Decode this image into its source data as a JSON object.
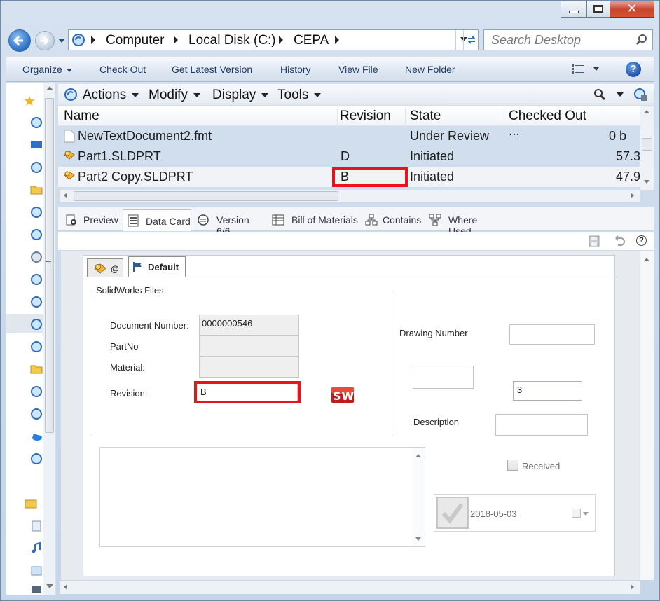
{
  "window": {
    "minimize_icon": "minimize-icon",
    "maximize_icon": "maximize-icon",
    "close_icon": "close-icon"
  },
  "address_bar": {
    "crumbs": [
      "Computer",
      "Local Disk (C:)",
      "CEPA"
    ],
    "search_placeholder": "Search Desktop"
  },
  "command_bar": {
    "items": [
      "Organize",
      "Check Out",
      "Get Latest Version",
      "History",
      "View File",
      "New Folder"
    ]
  },
  "pdm_menu": {
    "items": [
      "Actions",
      "Modify",
      "Display",
      "Tools"
    ]
  },
  "file_list": {
    "columns": [
      "Name",
      "Revision",
      "State",
      "Checked Out ..."
    ],
    "rows": [
      {
        "name": "NewTextDocument2.fmt",
        "revision": "",
        "state": "Under Review",
        "size": "0 b"
      },
      {
        "name": "Part1.SLDPRT",
        "revision": "D",
        "state": "Initiated",
        "size": "57.3"
      },
      {
        "name": "Part2 Copy.SLDPRT",
        "revision": "B",
        "state": "Initiated",
        "size": "47.9"
      }
    ]
  },
  "tabs": [
    "Preview",
    "Data Card",
    "Version 6/6",
    "Bill of Materials",
    "Contains",
    "Where Used"
  ],
  "data_card": {
    "config_tab_at": "@",
    "config_tab_default": "Default",
    "group_title": "SolidWorks Files",
    "document_number_label": "Document Number:",
    "document_number": "0000000546",
    "partno_label": "PartNo",
    "partno": "",
    "material_label": "Material:",
    "material": "",
    "revision_label": "Revision:",
    "revision": "B",
    "sw_logo": "SW",
    "drawing_number_label": "Drawing Number",
    "drawing_number": "",
    "field_3": "3",
    "description_label": "Description",
    "description": "",
    "received_label": "Received",
    "date": "2018-05-03"
  },
  "colors": {
    "highlight_red": "#e8141c",
    "accent_blue": "#1e3a5f"
  }
}
